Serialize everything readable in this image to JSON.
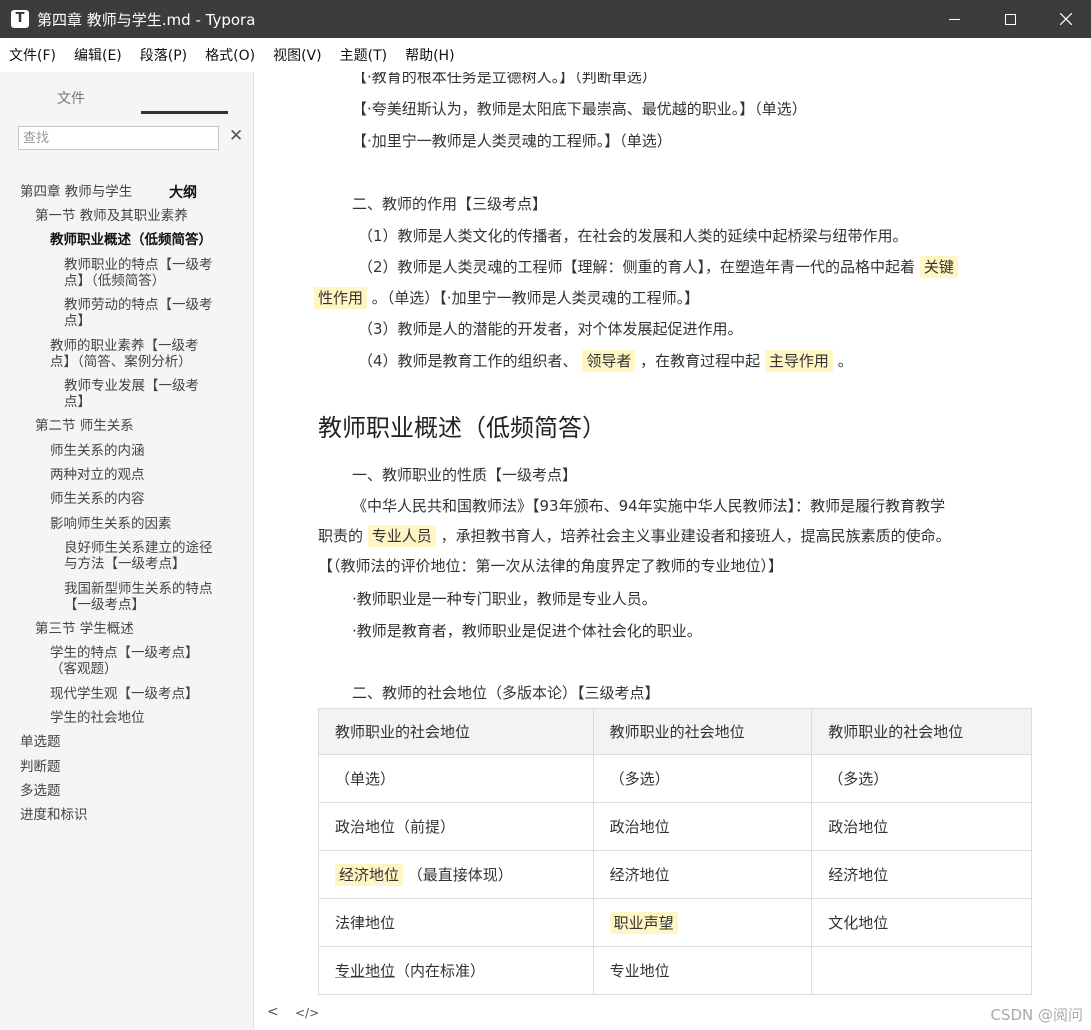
{
  "window": {
    "title": "第四章 教师与学生.md - Typora",
    "icon_letter": "T"
  },
  "menu": [
    "文件(F)",
    "编辑(E)",
    "段落(P)",
    "格式(O)",
    "视图(V)",
    "主题(T)",
    "帮助(H)"
  ],
  "sidebar": {
    "tab_files": "文件",
    "tab_outline": "大纲",
    "search_placeholder": "查找",
    "outline": [
      "第四章 教师与学生",
      "第一节 教师及其职业素养",
      "教师职业概述（低频简答）",
      "教师职业的特点【一级考",
      "点】（低频简答）",
      "教师劳动的特点【一级考",
      "点】",
      "教师的职业素养【一级考",
      "点】（简答、案例分析）",
      "教师专业发展【一级考",
      "点】",
      "第二节 师生关系",
      "师生关系的内涵",
      "两种对立的观点",
      "师生关系的内容",
      "影响师生关系的因素",
      "良好师生关系建立的途径",
      "与方法【一级考点】",
      "我国新型师生关系的特点",
      "【一级考点】",
      "第三节 学生概述",
      "学生的特点【一级考点】",
      "（客观题）",
      "现代学生观【一级考点】",
      "学生的社会地位",
      "单选题",
      "判断题",
      "多选题",
      "进度和标识"
    ]
  },
  "content": {
    "p_top_cut": "【·教育的根本任务是立德树人。】（判断单选）",
    "p1": "【·夸美纽斯认为，教师是太阳底下最崇高、最优越的职业。】（单选）",
    "p2": "【·加里宁一教师是人类灵魂的工程师。】（单选）",
    "p3": "二、教师的作用【三级考点】",
    "p4": "（1）教师是人类文化的传播者，在社会的发展和人类的延续中起桥梁与纽带作用。",
    "p5a": "（2）教师是人类灵魂的工程师【理解：侧重的育人】，在塑造年青一代的品格中起着",
    "p5mark1": "关键",
    "p5mark2": "性作用",
    "p5b": "。（单选）【·加里宁一教师是人类灵魂的工程师。】",
    "p6": "（3）教师是人的潜能的开发者，对个体发展起促进作用。",
    "p7a": "（4）教师是教育工作的组织者、",
    "p7mark1": "领导者",
    "p7b": "，在教育过程中起",
    "p7mark2": "主导作用",
    "p7c": "。",
    "h2": "教师职业概述（低频简答）",
    "p8": "一、教师职业的性质【一级考点】",
    "p9": "《中华人民共和国教师法》【93年颁布、94年实施中华人民教师法】：教师是履行教育教学",
    "p10a": "职责的",
    "p10mark": "专业人员",
    "p10b": "，承担教书育人，培养社会主义事业建设者和接班人，提高民族素质的使命。",
    "p11": "【（教师法的评价地位：第一次从法律的角度界定了教师的专业地位）】",
    "p12": "·教师职业是一种专门职业，教师是专业人员。",
    "p13": "·教师是教育者，教师职业是促进个体社会化的职业。",
    "p14": "二、教师的社会地位（多版本论）【三级考点】",
    "table": {
      "headers": [
        "教师职业的社会地位",
        "教师职业的社会地位",
        "教师职业的社会地位"
      ],
      "rows": [
        [
          "（单选）",
          "（多选）",
          "（多选）"
        ],
        [
          "政治地位（前提）",
          "政治地位",
          "政治地位"
        ],
        [
          "经济地位",
          "（最直接体现）",
          "经济地位",
          "经济地位"
        ],
        [
          "法律地位",
          "职业声望",
          "文化地位"
        ],
        [
          "专业地位",
          "（内在标准）",
          "专业地位",
          ""
        ]
      ]
    }
  },
  "footer": {
    "prev": "<",
    "source": "</>",
    "watermark": "CSDN @阅问"
  }
}
